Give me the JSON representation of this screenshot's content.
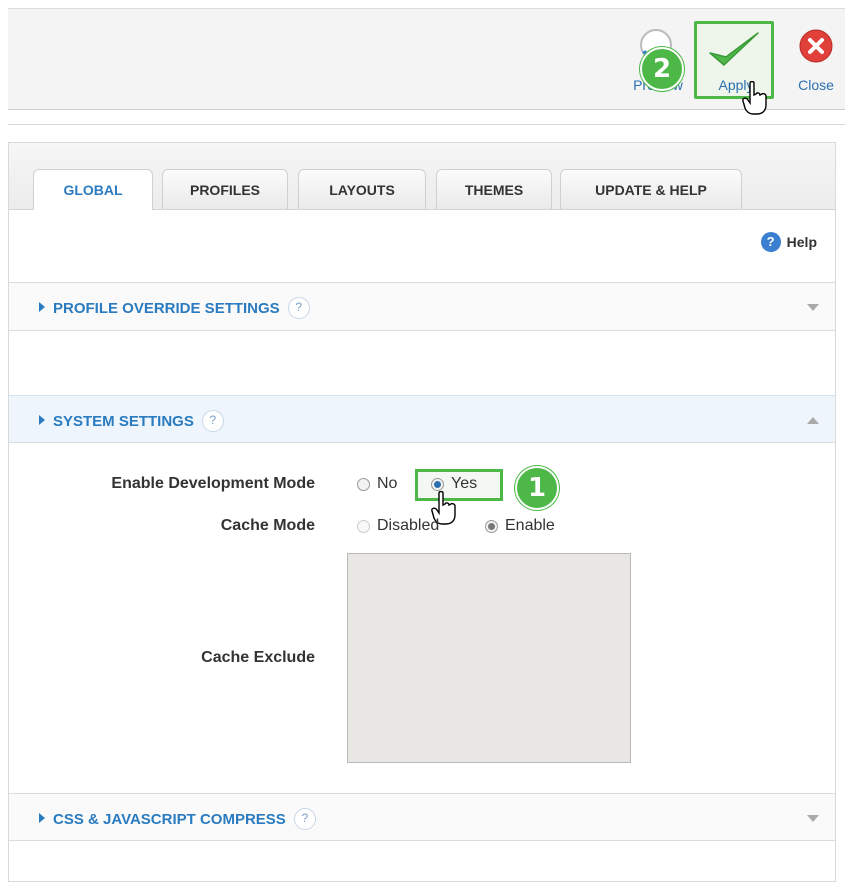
{
  "toolbar": {
    "preview_label": "Preview",
    "apply_label": "Apply",
    "close_label": "Close",
    "step_apply_badge": "2"
  },
  "tabs": [
    {
      "label": "GLOBAL",
      "active": true
    },
    {
      "label": "PROFILES",
      "active": false
    },
    {
      "label": "LAYOUTS",
      "active": false
    },
    {
      "label": "THEMES",
      "active": false
    },
    {
      "label": "UPDATE & HELP",
      "active": false
    }
  ],
  "help": {
    "label": "Help",
    "icon": "question-circle-icon"
  },
  "sections": {
    "profile_override": {
      "title": "PROFILE OVERRIDE SETTINGS",
      "expanded": false
    },
    "system": {
      "title": "SYSTEM SETTINGS",
      "expanded": true
    },
    "compress": {
      "title": "CSS & JAVASCRIPT COMPRESS",
      "expanded": false
    }
  },
  "system_settings": {
    "dev_mode": {
      "label": "Enable Development Mode",
      "options": [
        "No",
        "Yes"
      ],
      "selected": "Yes",
      "step_badge": "1"
    },
    "cache_mode": {
      "label": "Cache Mode",
      "options": [
        "Disabled",
        "Enable"
      ],
      "selected": "Enable",
      "disabled": true
    },
    "cache_exclude": {
      "label": "Cache Exclude",
      "value": ""
    }
  },
  "colors": {
    "accent": "#2a7bbf",
    "highlight_green": "#4db848",
    "close_red": "#e0403a"
  }
}
